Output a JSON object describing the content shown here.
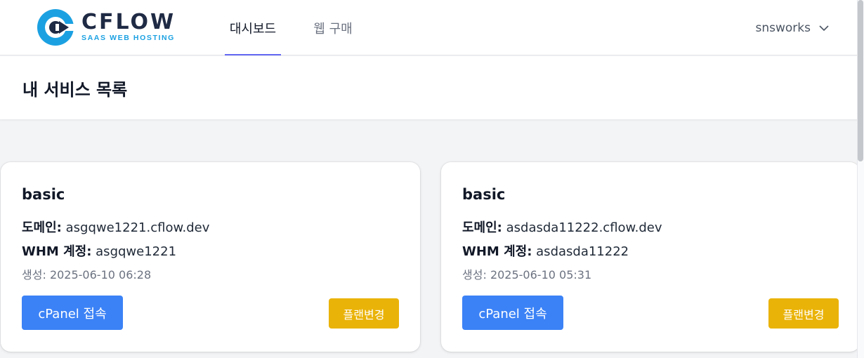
{
  "brand": {
    "title": "CFLOW",
    "subtitle": "SAAS WEB HOSTING",
    "colors": {
      "navy": "#1f2a44",
      "blue": "#1ba1e2"
    }
  },
  "nav": {
    "tabs": [
      {
        "label": "대시보드",
        "active": true
      },
      {
        "label": "웹 구매",
        "active": false
      }
    ],
    "user": "snsworks"
  },
  "page": {
    "title": "내 서비스 목록"
  },
  "labels": {
    "domain": "도메인:",
    "whm": "WHM 계정:",
    "created": "생성:",
    "cpanel_button": "cPanel 접속",
    "plan_button": "플랜변경"
  },
  "services": [
    {
      "plan": "basic",
      "domain": "asgqwe1221.cflow.dev",
      "whm_account": "asgqwe1221",
      "created": "2025-06-10 06:28"
    },
    {
      "plan": "basic",
      "domain": "asdasda11222.cflow.dev",
      "whm_account": "asdasda11222",
      "created": "2025-06-10 05:31"
    }
  ],
  "colors": {
    "primary_button": "#3b82f6",
    "plan_button": "#eab308",
    "active_tab_underline": "#6366f1"
  }
}
